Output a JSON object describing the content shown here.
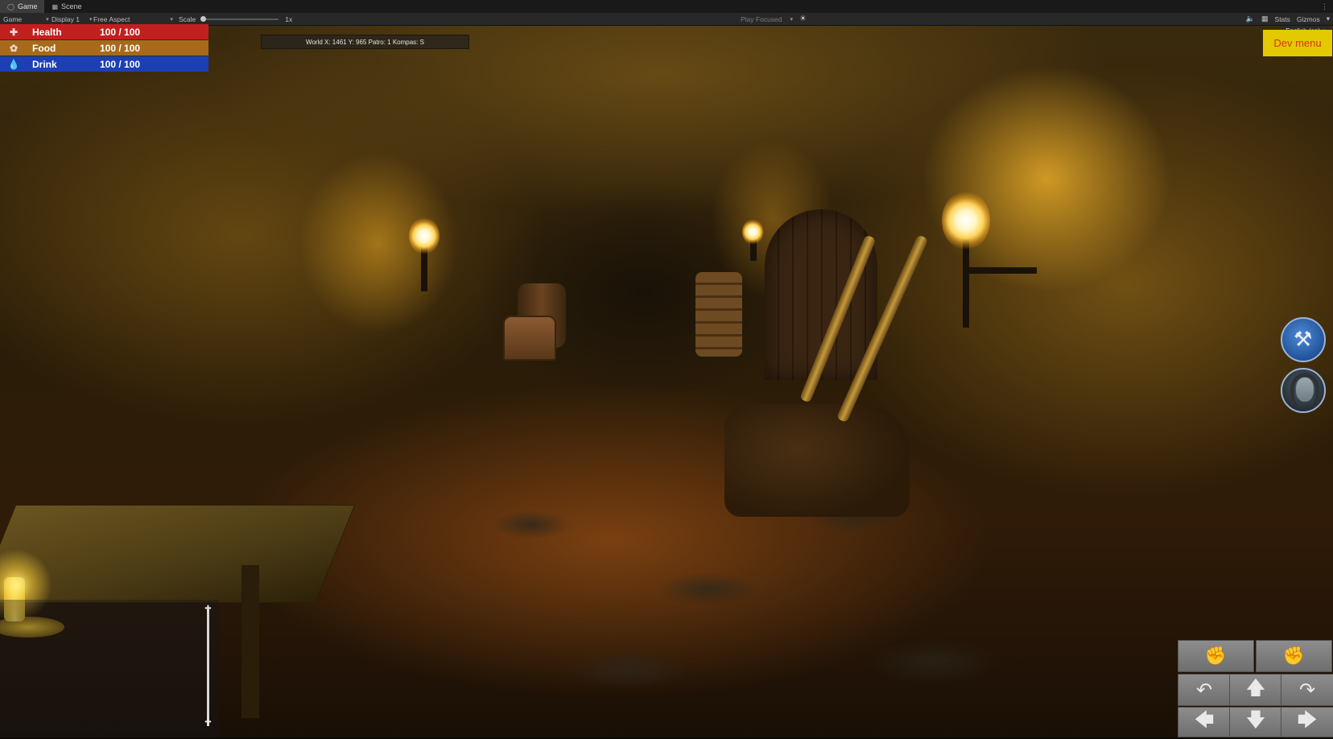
{
  "editor": {
    "tabs": [
      {
        "label": "Game",
        "icon": "gamepad-icon"
      },
      {
        "label": "Scene",
        "icon": "grid-icon"
      }
    ],
    "toolbar": {
      "game_view": "Game",
      "display": "Display 1",
      "aspect": "Free Aspect",
      "scale_label": "Scale",
      "scale_value": "1x",
      "play_mode": "Play Focused",
      "stats": "Stats",
      "gizmos": "Gizmos"
    }
  },
  "hud": {
    "stats": [
      {
        "label": "Health",
        "value": "100 / 100",
        "icon": "plus-cross-icon",
        "color": "#c21f1f",
        "level": 1.0
      },
      {
        "label": "Food",
        "value": "100 / 100",
        "icon": "drumstick-icon",
        "color": "#a66a1a",
        "level": 1.0
      },
      {
        "label": "Drink",
        "value": "100 / 100",
        "icon": "droplet-icon",
        "color": "#1c3fb3",
        "level": 1.0
      }
    ],
    "coordinates": "World X: 1461 Y: 965 Patro: 1 Kompas: S",
    "language": "English (en)",
    "dev_menu": "Dev menu",
    "side_buttons": [
      {
        "icon": "pickaxe-icon"
      },
      {
        "icon": "character-portrait"
      }
    ],
    "slider_level": 0.5,
    "controls": {
      "hands": [
        "fist-left-icon",
        "fist-right-icon"
      ],
      "row1": [
        "turn-left-icon",
        "arrow-up-icon",
        "turn-right-icon"
      ],
      "row2": [
        "arrow-left-icon",
        "arrow-down-icon",
        "arrow-right-icon"
      ]
    }
  },
  "colors": {
    "dev_menu_bg": "#e3c900",
    "dev_menu_text": "#d43a14"
  }
}
